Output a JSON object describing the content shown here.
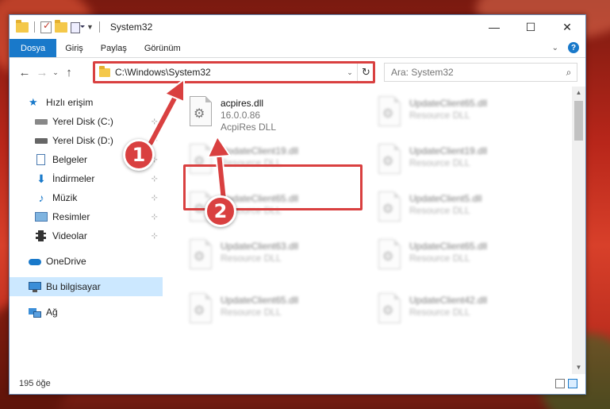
{
  "window": {
    "title": "System32",
    "controls": {
      "minimize": "—",
      "maximize": "☐",
      "close": "✕"
    }
  },
  "ribbon": {
    "tabs": [
      "Dosya",
      "Giriş",
      "Paylaş",
      "Görünüm"
    ],
    "expand": "⌄",
    "help": "?"
  },
  "nav": {
    "back": "←",
    "forward": "→",
    "recent": "⌄",
    "up": "↑",
    "address": "C:\\Windows\\System32",
    "address_dropdown": "⌄",
    "refresh": "↻",
    "search_placeholder": "Ara: System32",
    "search_icon": "⌕"
  },
  "sidebar": {
    "items": [
      {
        "label": "Hızlı erişim",
        "icon": "star-icon"
      },
      {
        "label": "Yerel Disk (C:)",
        "icon": "drive-icon",
        "pinned": true
      },
      {
        "label": "Yerel Disk (D:)",
        "icon": "drive-icon",
        "pinned": true
      },
      {
        "label": "Belgeler",
        "icon": "documents-icon",
        "pinned": true
      },
      {
        "label": "İndirmeler",
        "icon": "download-icon",
        "pinned": true
      },
      {
        "label": "Müzik",
        "icon": "music-icon",
        "pinned": true
      },
      {
        "label": "Resimler",
        "icon": "pictures-icon",
        "pinned": true
      },
      {
        "label": "Videolar",
        "icon": "video-icon",
        "pinned": true
      },
      {
        "label": "OneDrive",
        "icon": "cloud-icon"
      },
      {
        "label": "Bu bilgisayar",
        "icon": "computer-icon",
        "selected": true
      },
      {
        "label": "Ağ",
        "icon": "network-icon"
      }
    ],
    "pin_glyph": "📌"
  },
  "files": [
    {
      "name": "acpires.dll",
      "line2": "16.0.0.86",
      "line3": "AcpiRes DLL",
      "highlighted": true
    },
    {
      "name": "UpdateClient65.dll",
      "line2": "Resource DLL"
    },
    {
      "name": "UpdateClient19.dll",
      "line2": "Resource DLL"
    },
    {
      "name": "UpdateClient19.dll",
      "line2": "Resource DLL"
    },
    {
      "name": "UpdateClient65.dll",
      "line2": "Resource DLL"
    },
    {
      "name": "UpdateClient5.dll",
      "line2": "Resource DLL"
    },
    {
      "name": "UpdateClient63.dll",
      "line2": "Resource DLL"
    },
    {
      "name": "UpdateClient65.dll",
      "line2": "Resource DLL"
    },
    {
      "name": "UpdateClient65.dll",
      "line2": "Resource DLL"
    },
    {
      "name": "UpdateClient42.dll",
      "line2": "Resource DLL"
    }
  ],
  "status": {
    "item_count": "195 öğe"
  },
  "callouts": {
    "one": "1",
    "two": "2"
  },
  "colors": {
    "accent": "#1979ca",
    "highlight": "#d94040",
    "selection": "#cce8ff"
  }
}
